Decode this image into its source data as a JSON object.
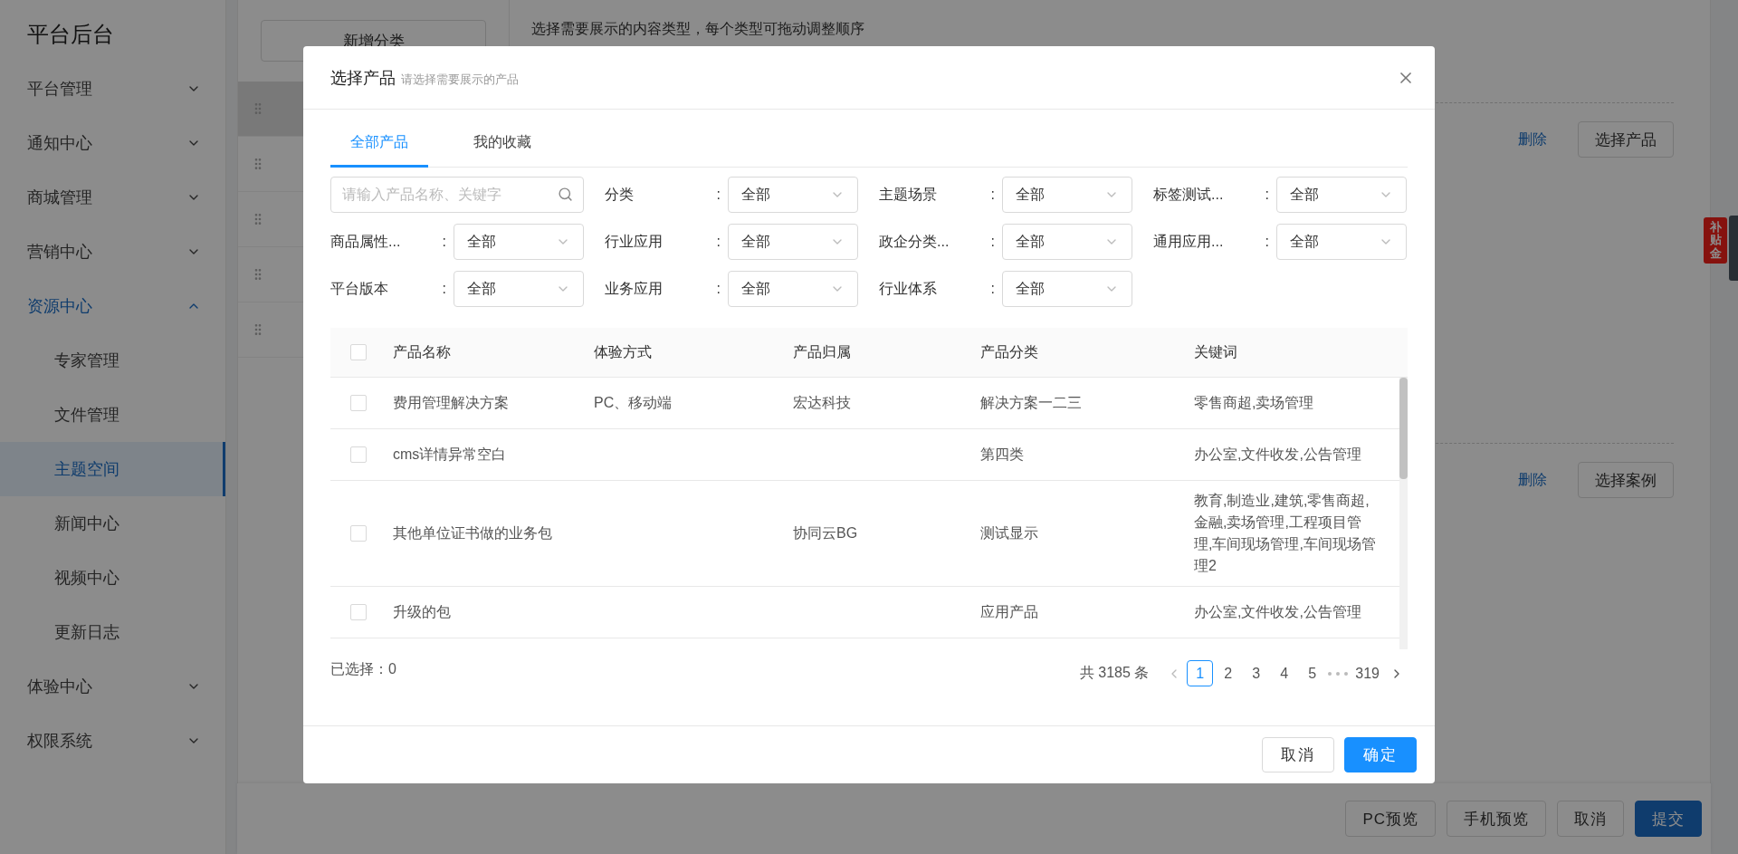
{
  "sidebar": {
    "title": "平台后台",
    "items": [
      {
        "label": "平台管理",
        "expanded": false,
        "selected": false
      },
      {
        "label": "通知中心",
        "expanded": false,
        "selected": false
      },
      {
        "label": "商城管理",
        "expanded": false,
        "selected": false
      },
      {
        "label": "营销中心",
        "expanded": false,
        "selected": false
      },
      {
        "label": "资源中心",
        "expanded": true,
        "selected": false,
        "children": [
          {
            "label": "专家管理",
            "selected": false
          },
          {
            "label": "文件管理",
            "selected": false
          },
          {
            "label": "主题空间",
            "selected": true
          },
          {
            "label": "新闻中心",
            "selected": false
          },
          {
            "label": "视频中心",
            "selected": false
          },
          {
            "label": "更新日志",
            "selected": false
          }
        ]
      },
      {
        "label": "体验中心",
        "expanded": false,
        "selected": false
      },
      {
        "label": "权限系统",
        "expanded": false,
        "selected": false
      }
    ]
  },
  "page": {
    "add_category_button": "新增分类",
    "categories": [
      {
        "selected": true
      },
      {
        "selected": false
      },
      {
        "selected": false
      },
      {
        "selected": false
      },
      {
        "selected": false
      }
    ],
    "hint": "选择需要展示的内容类型，每个类型可拖动调整顺序",
    "sections": [
      {
        "delete_link": "删除",
        "select_button": "选择产品"
      },
      {
        "delete_link": "删除",
        "select_button": "选择案例"
      }
    ],
    "actions": [
      {
        "label": "PC预览",
        "kind": "default"
      },
      {
        "label": "手机预览",
        "kind": "default"
      },
      {
        "label": "取消",
        "kind": "default"
      },
      {
        "label": "提交",
        "kind": "primary"
      }
    ],
    "float_badge": "补贴金"
  },
  "dialog": {
    "title": "选择产品",
    "subtitle": "请选择需要展示的产品",
    "tabs": [
      {
        "label": "全部产品",
        "selected": true
      },
      {
        "label": "我的收藏",
        "selected": false
      }
    ],
    "search": {
      "placeholder": "请输入产品名称、关键字"
    },
    "filters": [
      {
        "label": "分类",
        "colon": ":",
        "value": "全部"
      },
      {
        "label": "主题场景",
        "colon": ":",
        "value": "全部"
      },
      {
        "label": "标签测试...",
        "colon": ":",
        "value": "全部"
      },
      {
        "label": "商品属性...",
        "colon": ":",
        "value": "全部"
      },
      {
        "label": "行业应用",
        "colon": ":",
        "value": "全部"
      },
      {
        "label": "政企分类...",
        "colon": ":",
        "value": "全部"
      },
      {
        "label": "通用应用...",
        "colon": ":",
        "value": "全部"
      },
      {
        "label": "平台版本",
        "colon": ":",
        "value": "全部"
      },
      {
        "label": "业务应用",
        "colon": ":",
        "value": "全部"
      },
      {
        "label": "行业体系",
        "colon": ":",
        "value": "全部"
      }
    ],
    "table": {
      "header_checked": false,
      "columns": [
        "产品名称",
        "体验方式",
        "产品归属",
        "产品分类",
        "关键词"
      ],
      "rows": [
        {
          "checked": false,
          "cells": [
            "费用管理解决方案",
            "PC、移动端",
            "宏达科技",
            "解决方案一二三",
            "零售商超,卖场管理"
          ]
        },
        {
          "checked": false,
          "cells": [
            "cms详情异常空白",
            "",
            "",
            "第四类",
            "办公室,文件收发,公告管理"
          ]
        },
        {
          "checked": false,
          "cells": [
            "其他单位证书做的业务包",
            "",
            "协同云BG",
            "测试显示",
            "教育,制造业,建筑,零售商超,金融,卖场管理,工程项目管理,车间现场管理,车间现场管理2"
          ]
        },
        {
          "checked": false,
          "cells": [
            "升级的包",
            "",
            "",
            "应用产品",
            "办公室,文件收发,公告管理"
          ]
        }
      ]
    },
    "selected_count": "已选择：0",
    "pagination": {
      "total": "共 3185 条",
      "pages": [
        {
          "label": "1",
          "selected": true
        },
        {
          "label": "2",
          "selected": false
        },
        {
          "label": "3",
          "selected": false
        },
        {
          "label": "4",
          "selected": false
        },
        {
          "label": "5",
          "selected": false
        },
        {
          "kind": "ellipsis"
        },
        {
          "label": "319",
          "selected": false
        }
      ]
    },
    "buttons": [
      {
        "label": "取消",
        "kind": "default"
      },
      {
        "label": "确定",
        "kind": "primary"
      }
    ]
  }
}
